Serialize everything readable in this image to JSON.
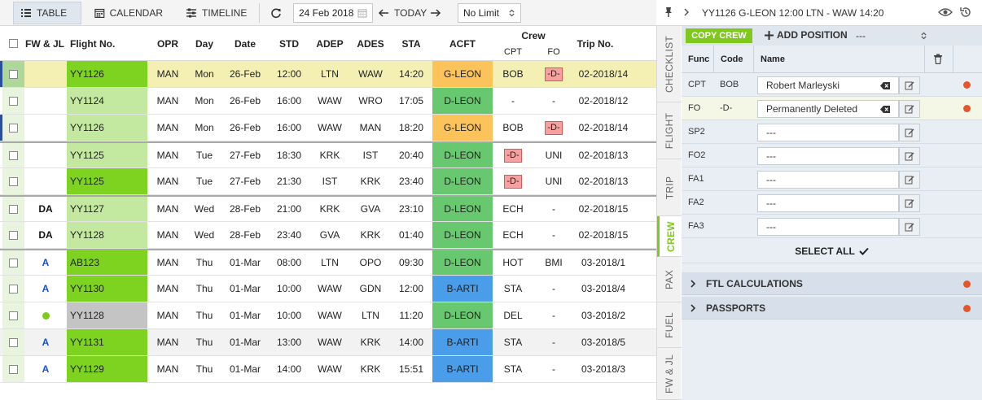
{
  "toolbar": {
    "table_label": "TABLE",
    "calendar_label": "CALENDAR",
    "timeline_label": "TIMELINE",
    "date_value": "24 Feb 2018",
    "today_label": "TODAY",
    "limit_value": "No Limit"
  },
  "columns": {
    "fwjl": "FW & JL",
    "flight": "Flight No.",
    "opr": "OPR",
    "day": "Day",
    "date": "Date",
    "std": "STD",
    "adep": "ADEP",
    "ades": "ADES",
    "sta": "STA",
    "acft": "ACFT",
    "crew": "Crew",
    "cpt": "CPT",
    "fo": "FO",
    "trip": "Trip No."
  },
  "rows": [
    {
      "fwjl": "",
      "flight": "YY1126",
      "opr": "MAN",
      "day": "Mon",
      "date": "26-Feb",
      "std": "12:00",
      "adep": "LTN",
      "ades": "WAW",
      "sta": "14:20",
      "acft": "G-LEON",
      "cpt": "BOB",
      "fo": "-D-",
      "trip": "02-2018/14"
    },
    {
      "fwjl": "",
      "flight": "YY1124",
      "opr": "MAN",
      "day": "Mon",
      "date": "26-Feb",
      "std": "16:00",
      "adep": "WAW",
      "ades": "WRO",
      "sta": "17:05",
      "acft": "D-LEON",
      "cpt": "-",
      "fo": "-",
      "trip": "02-2018/12"
    },
    {
      "fwjl": "",
      "flight": "YY1126",
      "opr": "MAN",
      "day": "Mon",
      "date": "26-Feb",
      "std": "16:00",
      "adep": "WAW",
      "ades": "MAN",
      "sta": "18:20",
      "acft": "G-LEON",
      "cpt": "BOB",
      "fo": "-D-",
      "trip": "02-2018/14"
    },
    {
      "fwjl": "",
      "flight": "YY1125",
      "opr": "MAN",
      "day": "Tue",
      "date": "27-Feb",
      "std": "18:30",
      "adep": "KRK",
      "ades": "IST",
      "sta": "20:40",
      "acft": "D-LEON",
      "cpt": "-D-",
      "fo": "UNI",
      "trip": "02-2018/13"
    },
    {
      "fwjl": "",
      "flight": "YY1125",
      "opr": "MAN",
      "day": "Tue",
      "date": "27-Feb",
      "std": "21:30",
      "adep": "IST",
      "ades": "KRK",
      "sta": "23:40",
      "acft": "D-LEON",
      "cpt": "-D-",
      "fo": "UNI",
      "trip": "02-2018/13"
    },
    {
      "fwjl": "DA",
      "flight": "YY1127",
      "opr": "MAN",
      "day": "Wed",
      "date": "28-Feb",
      "std": "21:00",
      "adep": "KRK",
      "ades": "GVA",
      "sta": "23:10",
      "acft": "D-LEON",
      "cpt": "ECH",
      "fo": "-",
      "trip": "02-2018/15"
    },
    {
      "fwjl": "DA",
      "flight": "YY1128",
      "opr": "MAN",
      "day": "Wed",
      "date": "28-Feb",
      "std": "23:40",
      "adep": "GVA",
      "ades": "KRK",
      "sta": "01:40",
      "acft": "D-LEON",
      "cpt": "ECH",
      "fo": "-",
      "trip": "02-2018/15"
    },
    {
      "fwjl": "A",
      "flight": "AB123",
      "opr": "MAN",
      "day": "Thu",
      "date": "01-Mar",
      "std": "08:00",
      "adep": "LTN",
      "ades": "OPO",
      "sta": "09:30",
      "acft": "D-LEON",
      "cpt": "HOT",
      "fo": "BMI",
      "trip": "03-2018/1"
    },
    {
      "fwjl": "A",
      "flight": "YY1130",
      "opr": "MAN",
      "day": "Thu",
      "date": "01-Mar",
      "std": "10:00",
      "adep": "WAW",
      "ades": "GDN",
      "sta": "12:00",
      "acft": "B-ARTI",
      "cpt": "STA",
      "fo": "-",
      "trip": "03-2018/4"
    },
    {
      "fwjl": "",
      "flight": "YY1128",
      "opr": "MAN",
      "day": "Thu",
      "date": "01-Mar",
      "std": "10:00",
      "adep": "WAW",
      "ades": "LTN",
      "sta": "11:20",
      "acft": "D-LEON",
      "cpt": "DEL",
      "fo": "-",
      "trip": "03-2018/2"
    },
    {
      "fwjl": "A",
      "flight": "YY1131",
      "opr": "MAN",
      "day": "Thu",
      "date": "01-Mar",
      "std": "13:00",
      "adep": "WAW",
      "ades": "KRK",
      "sta": "14:00",
      "acft": "B-ARTI",
      "cpt": "STA",
      "fo": "-",
      "trip": "03-2018/5"
    },
    {
      "fwjl": "A",
      "flight": "YY1129",
      "opr": "MAN",
      "day": "Thu",
      "date": "01-Mar",
      "std": "14:00",
      "adep": "WAW",
      "ades": "KRK",
      "sta": "15:51",
      "acft": "B-ARTI",
      "cpt": "STA",
      "fo": "-",
      "trip": "03-2018/3"
    }
  ],
  "tabs": [
    "CHECKLIST",
    "FLIGHT",
    "TRIP",
    "CREW",
    "PAX",
    "FUEL",
    "FW & JL"
  ],
  "panel": {
    "title": "YY1126 G-LEON 12:00 LTN - WAW 14:20",
    "copy_crew": "COPY CREW",
    "add_position": "ADD POSITION",
    "position_select": "---",
    "col_func": "Func",
    "col_code": "Code",
    "col_name": "Name",
    "crew": [
      {
        "func": "CPT",
        "code": "BOB",
        "name": "Robert Marleyski"
      },
      {
        "func": "FO",
        "code": "-D-",
        "name": "Permanently Deleted"
      },
      {
        "func": "SP2",
        "code": "",
        "name": "---"
      },
      {
        "func": "FO2",
        "code": "",
        "name": "---"
      },
      {
        "func": "FA1",
        "code": "",
        "name": "---"
      },
      {
        "func": "FA2",
        "code": "",
        "name": "---"
      },
      {
        "func": "FA3",
        "code": "",
        "name": "---"
      }
    ],
    "select_all": "SELECT ALL",
    "ftl": "FTL CALCULATIONS",
    "passports": "PASSPORTS"
  },
  "colors": {
    "flight_green": "#7ed321",
    "flight_light": "#c3e89f",
    "flight_grey": "#c4c4c4",
    "acft_orange": "#fbc35a",
    "acft_green": "#67c86f",
    "acft_blue": "#4a9de8",
    "deleted_red": "#f7a0a0",
    "status_dot": "#e8532a"
  }
}
